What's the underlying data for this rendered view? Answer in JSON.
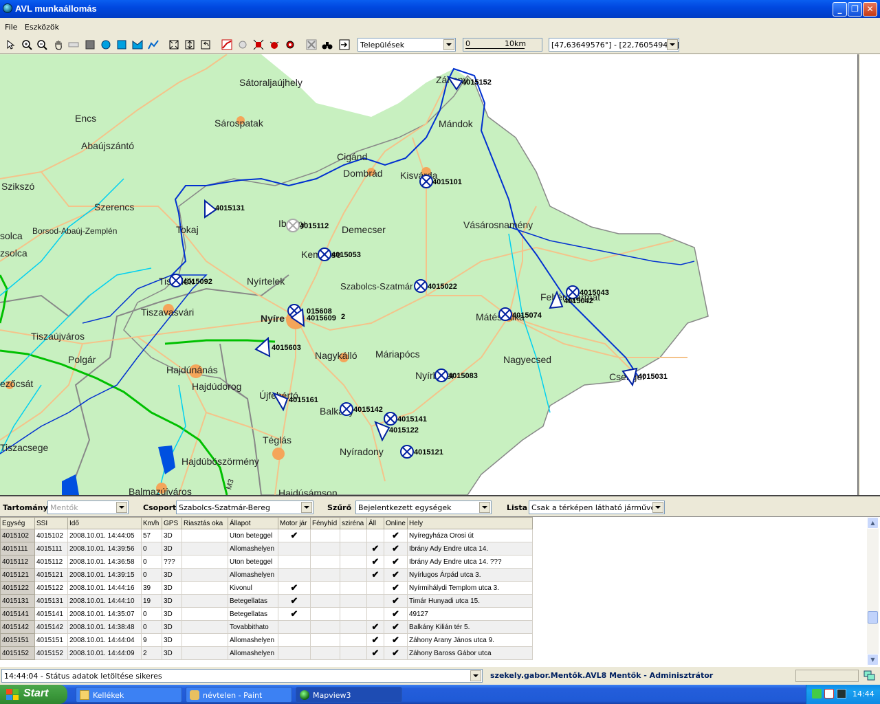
{
  "window": {
    "title": "AVL munkaállomás",
    "min": "_",
    "max": "❐",
    "close": "✕"
  },
  "menu": [
    "File",
    "Eszközök"
  ],
  "toolbar": {
    "layer_select": "Települések",
    "scale_zero": "0",
    "scale_label": "10km",
    "coords": "[47,63649576°] - [22,76054946°]"
  },
  "map": {
    "cities": [
      {
        "name": "Sátoraljaújhely"
      },
      {
        "name": "Encs"
      },
      {
        "name": "Sárospatak"
      },
      {
        "name": "Abaújszántó"
      },
      {
        "name": "Mándok"
      },
      {
        "name": "Cigánd"
      },
      {
        "name": "Dombrád"
      },
      {
        "name": "Kisvárda"
      },
      {
        "name": "Szikszó"
      },
      {
        "name": "Szerencs"
      },
      {
        "name": "Tokaj"
      },
      {
        "name": "Borsod-Abaúj-Zemplén"
      },
      {
        "name": "Demecser"
      },
      {
        "name": "Vásárosnamény"
      },
      {
        "name": "solca"
      },
      {
        "name": "zsolca"
      },
      {
        "name": "Nyírtelek"
      },
      {
        "name": "Szabolcs-Szatmár"
      },
      {
        "name": "Tiszavasvári"
      },
      {
        "name": "Nyíre"
      },
      {
        "name": "Mátészalka"
      },
      {
        "name": "Tiszaújváros"
      },
      {
        "name": "Nagykálló"
      },
      {
        "name": "Máriapócs"
      },
      {
        "name": "Polgár"
      },
      {
        "name": "Nagyecsed"
      },
      {
        "name": "Hajdúnánás"
      },
      {
        "name": "Hajdúdorog"
      },
      {
        "name": "ezőcsát"
      },
      {
        "name": "Újfehértó"
      },
      {
        "name": "Balkány"
      },
      {
        "name": "Téglás"
      },
      {
        "name": "Tiszacsege"
      },
      {
        "name": "Nyíradony"
      },
      {
        "name": "Hajdúböszörmény"
      },
      {
        "name": "Balmazújváros"
      },
      {
        "name": "Hajdúsámson"
      },
      {
        "name": "Ibrány"
      },
      {
        "name": "Kemecse"
      },
      {
        "name": "Csenger"
      },
      {
        "name": "Fehérgyarmat"
      },
      {
        "name": "Nyírbátor"
      },
      {
        "name": "Záhony"
      },
      {
        "name": "Tiszalök"
      },
      {
        "name": "M3"
      }
    ],
    "units": [
      {
        "id": "4015152"
      },
      {
        "id": "4015101"
      },
      {
        "id": "4015131"
      },
      {
        "id": "4015112"
      },
      {
        "id": "4015053"
      },
      {
        "id": "4015092"
      },
      {
        "id": "4015022"
      },
      {
        "id": "4015043"
      },
      {
        "id": "4015042"
      },
      {
        "id": "015608"
      },
      {
        "id": "4015609"
      },
      {
        "id": "2"
      },
      {
        "id": "4015074"
      },
      {
        "id": "4015603"
      },
      {
        "id": "4015083"
      },
      {
        "id": "4015031"
      },
      {
        "id": "4015161"
      },
      {
        "id": "4015142"
      },
      {
        "id": "4015141"
      },
      {
        "id": "4015122"
      },
      {
        "id": "4015121"
      }
    ]
  },
  "filters": {
    "tartomany_label": "Tartomány",
    "tartomany_value": "Mentők",
    "csoport_label": "Csoport",
    "csoport_value": "Szabolcs-Szatmár-Bereg",
    "szuro_label": "Szűrő",
    "szuro_value": "Bejelentkezett egységek",
    "lista_label": "Lista",
    "lista_value": "Csak a térképen látható járművek"
  },
  "table": {
    "headers": [
      "Egység",
      "SSI",
      "Idő",
      "Km/h",
      "GPS",
      "Riasztás oka",
      "Állapot",
      "Motor jár",
      "Fényhíd",
      "sziréna",
      "Áll",
      "Online",
      "Hely"
    ],
    "rows": [
      [
        "4015102",
        "4015102",
        "2008.10.01. 14:44:05",
        "57",
        "3D",
        "",
        "Uton beteggel",
        "✔",
        "",
        "",
        "",
        "✔",
        "Nyíregyháza Orosi út"
      ],
      [
        "4015111",
        "4015111",
        "2008.10.01. 14:39:56",
        "0",
        "3D",
        "",
        "Allomashelyen",
        "",
        "",
        "",
        "✔",
        "✔",
        "Ibrány Ady Endre utca 14."
      ],
      [
        "4015112",
        "4015112",
        "2008.10.01. 14:36:58",
        "0",
        "???",
        "",
        "Uton beteggel",
        "",
        "",
        "",
        "✔",
        "✔",
        "Ibrány Ady Endre utca 14.  ???"
      ],
      [
        "4015121",
        "4015121",
        "2008.10.01. 14:39:15",
        "0",
        "3D",
        "",
        "Allomashelyen",
        "",
        "",
        "",
        "✔",
        "✔",
        "Nyírlugos Árpád utca 3."
      ],
      [
        "4015122",
        "4015122",
        "2008.10.01. 14:44:16",
        "39",
        "3D",
        "",
        "Kivonul",
        "✔",
        "",
        "",
        "",
        "✔",
        "Nyírmihálydi Templom utca 3."
      ],
      [
        "4015131",
        "4015131",
        "2008.10.01. 14:44:10",
        "19",
        "3D",
        "",
        "Betegellatas",
        "✔",
        "",
        "",
        "",
        "✔",
        "Timár Hunyadi utca 15."
      ],
      [
        "4015141",
        "4015141",
        "2008.10.01. 14:35:07",
        "0",
        "3D",
        "",
        "Betegellatas",
        "✔",
        "",
        "",
        "",
        "✔",
        "49127"
      ],
      [
        "4015142",
        "4015142",
        "2008.10.01. 14:38:48",
        "0",
        "3D",
        "",
        "Tovabbithato",
        "",
        "",
        "",
        "✔",
        "✔",
        "Balkány Kilián tér 5."
      ],
      [
        "4015151",
        "4015151",
        "2008.10.01. 14:44:04",
        "9",
        "3D",
        "",
        "Allomashelyen",
        "",
        "",
        "",
        "✔",
        "✔",
        "Záhony Arany János utca 9."
      ],
      [
        "4015152",
        "4015152",
        "2008.10.01. 14:44:09",
        "2",
        "3D",
        "",
        "Allomashelyen",
        "",
        "",
        "",
        "✔",
        "✔",
        "Záhony Baross Gábor utca"
      ]
    ]
  },
  "status": {
    "message": "14:44:04 - Státus adatok letöltése sikeres",
    "user": "szekely.gabor.Mentők.AVL8 Mentők - Adminisztrátor"
  },
  "taskbar": {
    "start": "Start",
    "tasks": [
      "Kellékek",
      "névtelen - Paint",
      "Mapview3"
    ],
    "clock": "14:44"
  }
}
